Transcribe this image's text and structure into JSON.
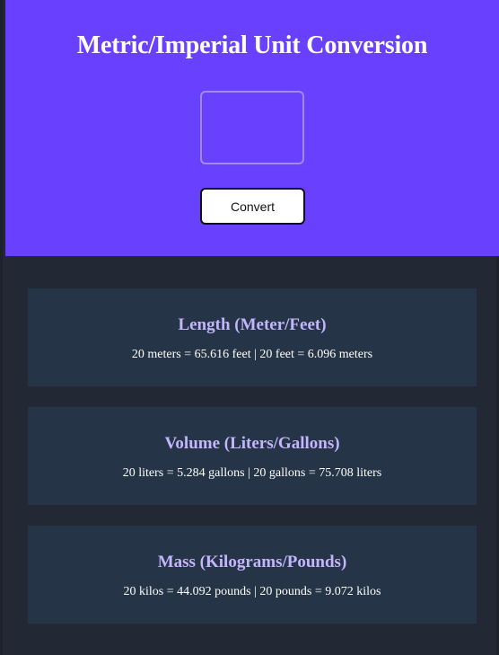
{
  "header": {
    "title": "Metric/Imperial Unit Conversion",
    "input_value": "",
    "convert_label": "Convert",
    "background_color": "#6a40ff"
  },
  "cards": [
    {
      "title": "Length (Meter/Feet)",
      "text": "20 meters = 65.616 feet | 20 feet = 6.096 meters"
    },
    {
      "title": "Volume (Liters/Gallons)",
      "text": "20 liters = 5.284 gallons | 20 gallons = 75.708 liters"
    },
    {
      "title": "Mass (Kilograms/Pounds)",
      "text": "20 kilos = 44.092 pounds | 20 pounds = 9.072 kilos"
    }
  ],
  "colors": {
    "page_background": "#222834",
    "card_background": "#253446",
    "card_title": "#c4b5fd",
    "card_text": "#ffffff"
  }
}
